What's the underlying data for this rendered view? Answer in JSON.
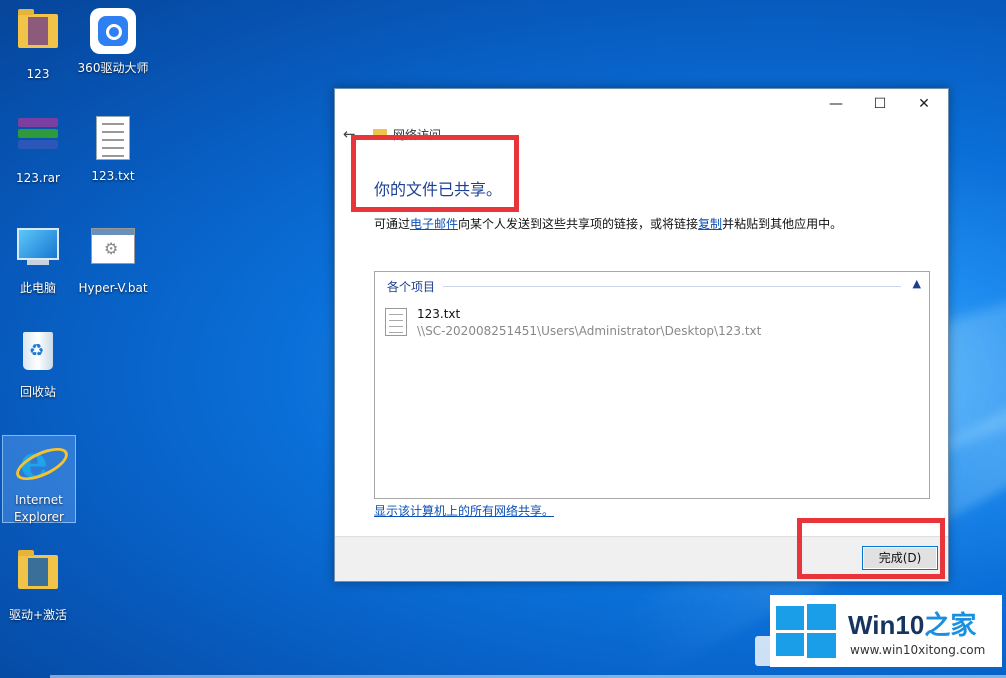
{
  "desktop": {
    "icons": [
      {
        "label": "123",
        "icon": "folder-icon"
      },
      {
        "label": "360驱动大师",
        "icon": "driver-app-icon"
      },
      {
        "label": "123.rar",
        "icon": "winrar-archive-icon"
      },
      {
        "label": "123.txt",
        "icon": "text-file-icon"
      },
      {
        "label": "此电脑",
        "icon": "computer-icon"
      },
      {
        "label": "Hyper-V.bat",
        "icon": "batch-file-icon"
      },
      {
        "label": "回收站",
        "icon": "recycle-bin-icon"
      },
      {
        "label": "Internet Explorer",
        "icon": "internet-explorer-icon"
      },
      {
        "label": "驱动+激活",
        "icon": "folder-icon"
      }
    ]
  },
  "dialog": {
    "window_buttons": {
      "minimize": "—",
      "maximize": "☐",
      "close": "✕"
    },
    "back_glyph": "←",
    "nav_title": "网络访问",
    "heading": "你的文件已共享。",
    "description": {
      "part1": "可通过",
      "email_link": "电子邮件",
      "part2": "向某个人发送到这些共享项的链接，或将链接",
      "copy_link": "复制",
      "part3": "并粘贴到其他应用中。"
    },
    "group_title": "各个项目",
    "collapse_glyph": "▲",
    "file": {
      "name": "123.txt",
      "path": "\\\\SC-202008251451\\Users\\Administrator\\Desktop\\123.txt"
    },
    "show_all_link": "显示该计算机上的所有网络共享。",
    "done_button": "完成(D)"
  },
  "watermark": {
    "title_main": "Win10",
    "title_accent": "之家",
    "url": "www.win10xitong.com"
  },
  "colors": {
    "heading": "#1c3f95",
    "link": "#0b4fb5",
    "highlight_box": "#e8343b",
    "desktop_blue": "#0a6fd8"
  }
}
